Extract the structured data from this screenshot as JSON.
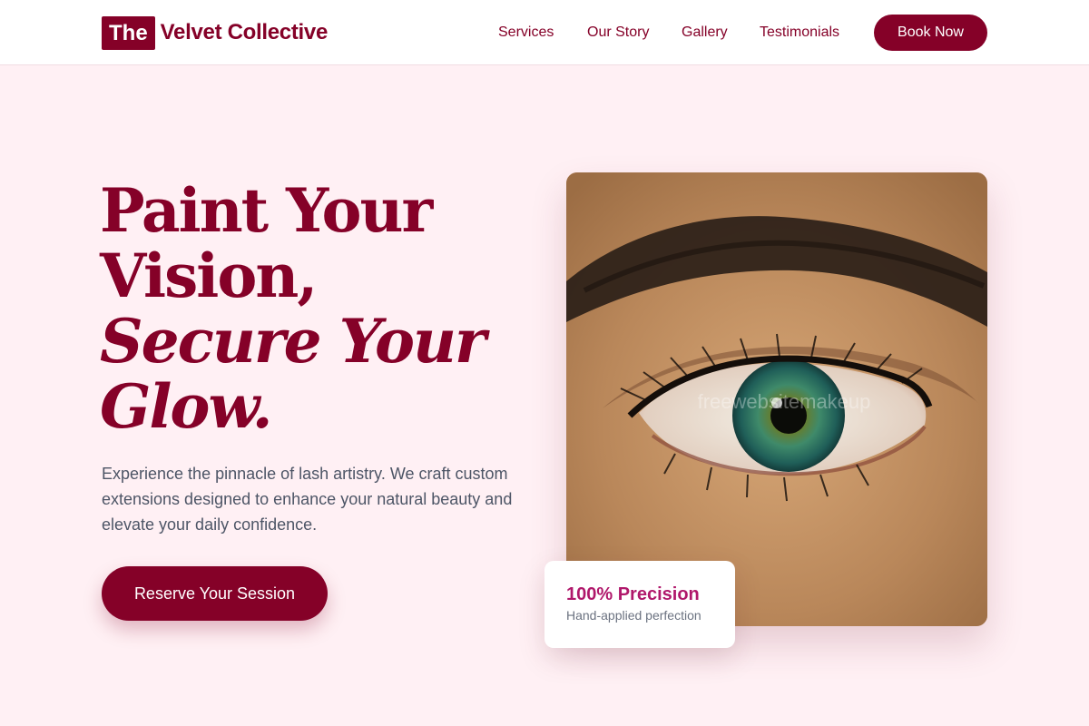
{
  "brand": {
    "mark": "The",
    "name": "Velvet Collective"
  },
  "nav": {
    "items": [
      {
        "label": "Services"
      },
      {
        "label": "Our Story"
      },
      {
        "label": "Gallery"
      },
      {
        "label": "Testimonials"
      }
    ],
    "book_label": "Book Now"
  },
  "hero": {
    "title_lines": [
      "Paint Your",
      "Vision,",
      "Secure Your",
      "Glow."
    ],
    "description": "Experience the pinnacle of lash artistry. We craft custom extensions designed to enhance your natural beauty and elevate your daily confidence.",
    "cta_label": "Reserve Your Session",
    "image_watermark": "freewebsitemakeup"
  },
  "badge": {
    "title": "100% Precision",
    "subtitle": "Hand-applied perfection"
  },
  "colors": {
    "brand": "#850128",
    "background": "#fff0f4",
    "badge_accent": "#b0186b"
  }
}
